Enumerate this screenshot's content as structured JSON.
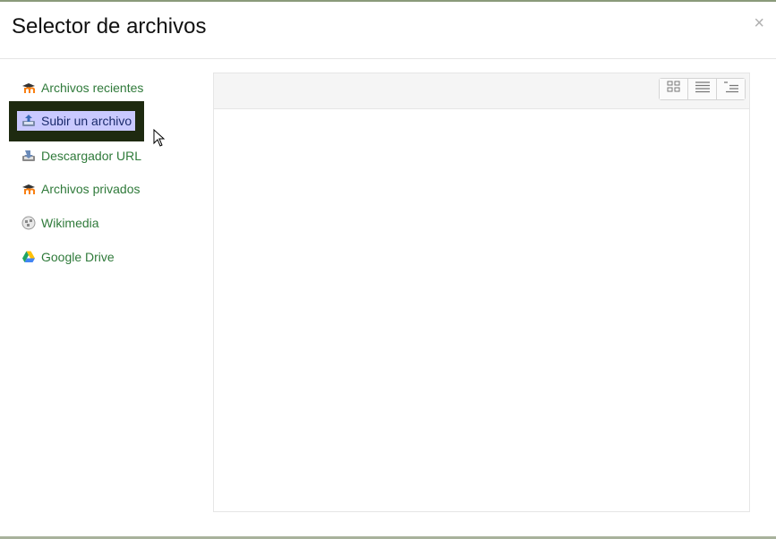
{
  "dialog": {
    "title": "Selector de archivos",
    "close_label": "×"
  },
  "sidebar": {
    "items": [
      {
        "label": "Archivos recientes",
        "icon": "moodle-icon"
      },
      {
        "label": "Subir un archivo",
        "icon": "upload-icon",
        "selected": true
      },
      {
        "label": "Descargador URL",
        "icon": "url-download-icon"
      },
      {
        "label": "Archivos privados",
        "icon": "moodle-icon"
      },
      {
        "label": "Wikimedia",
        "icon": "wikimedia-icon"
      },
      {
        "label": "Google Drive",
        "icon": "google-drive-icon"
      }
    ]
  },
  "toolbar": {
    "views": [
      "icons-view",
      "list-view",
      "tree-view"
    ]
  },
  "colors": {
    "link": "#2f7a3a",
    "selected_bg": "#c9c9ff",
    "selected_frame": "#1e2a10"
  }
}
